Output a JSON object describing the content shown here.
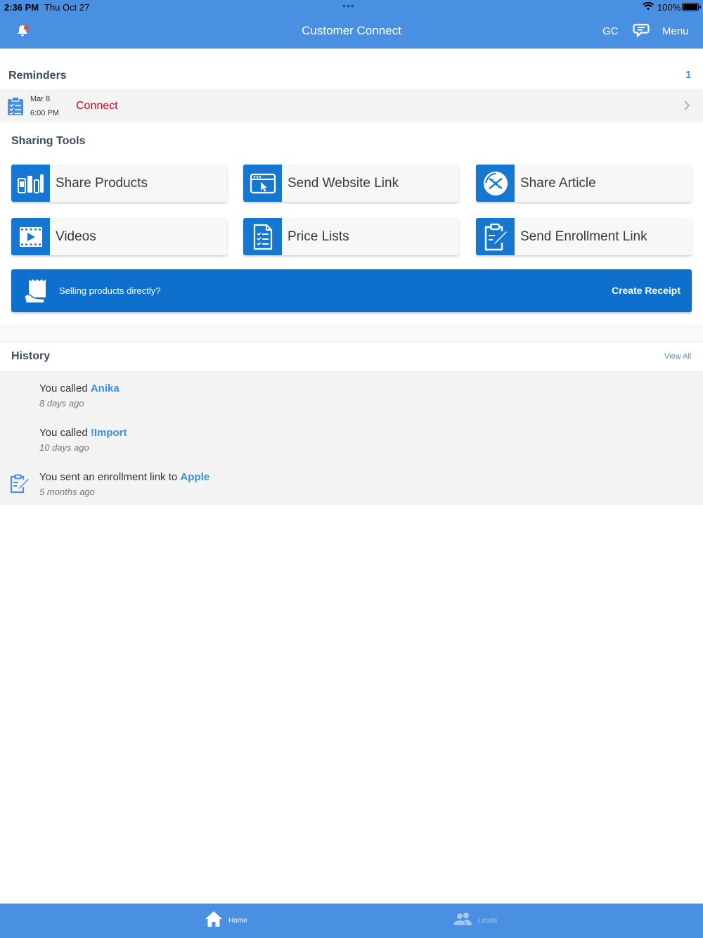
{
  "status_bar": {
    "time": "2:36 PM",
    "date": "Thu Oct 27",
    "battery": "100%"
  },
  "header": {
    "title": "Customer Connect",
    "initials": "GC",
    "menu_label": "Menu"
  },
  "reminders": {
    "title": "Reminders",
    "count": "1",
    "items": [
      {
        "date": "Mar 8",
        "time": "6:00 PM",
        "title": "Connect"
      }
    ]
  },
  "sharing_tools": {
    "title": "Sharing Tools",
    "tools": [
      {
        "label": "Share Products",
        "icon": "products-icon"
      },
      {
        "label": "Send Website Link",
        "icon": "browser-cursor-icon"
      },
      {
        "label": "Share Article",
        "icon": "dna-article-icon"
      },
      {
        "label": "Videos",
        "icon": "video-film-icon"
      },
      {
        "label": "Price Lists",
        "icon": "checklist-icon"
      },
      {
        "label": "Send Enrollment Link",
        "icon": "clipboard-pen-icon"
      }
    ],
    "receipt": {
      "question": "Selling products directly?",
      "button": "Create Receipt"
    }
  },
  "history": {
    "title": "History",
    "view_all": "View All",
    "items": [
      {
        "prefix": "You called ",
        "name": "Anika",
        "ago": "8 days ago"
      },
      {
        "prefix": "You called ",
        "name": "!Import",
        "ago": "10 days ago"
      },
      {
        "prefix": "You sent an enrollment link to ",
        "name": "Apple",
        "ago": "5 months ago"
      }
    ]
  },
  "tabbar": {
    "tabs": [
      {
        "label": "Home",
        "active": true
      },
      {
        "label": "Leads",
        "active": false
      }
    ]
  },
  "colors": {
    "primary": "#4a90e2",
    "tool_blue": "#1577d1",
    "reminder_red": "#d0021b"
  }
}
